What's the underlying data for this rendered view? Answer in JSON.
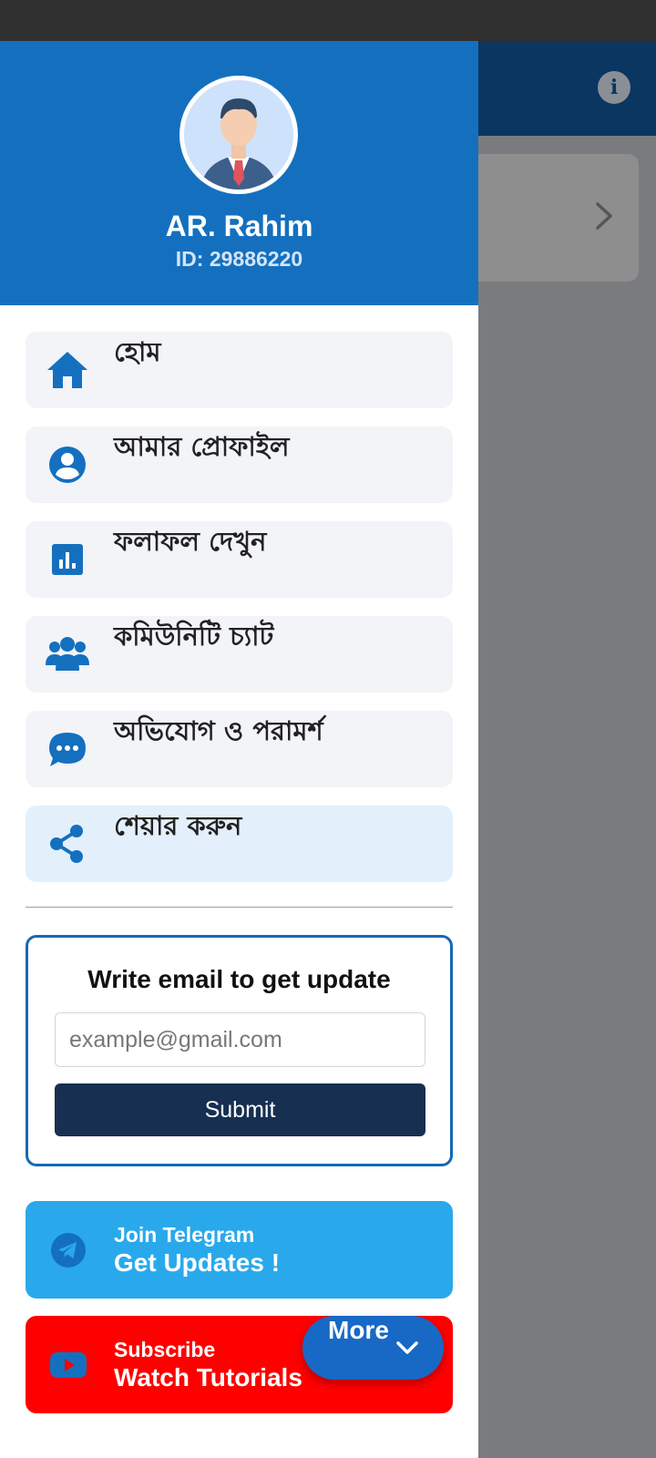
{
  "profile": {
    "name": "AR. Rahim",
    "id_text": "ID: 29886220"
  },
  "menu": {
    "items": [
      {
        "label": "হোম",
        "icon": "home-icon"
      },
      {
        "label": "আমার প্রোফাইল",
        "icon": "account-circle-icon"
      },
      {
        "label": "ফলাফল দেখুন",
        "icon": "bar-chart-icon"
      },
      {
        "label": "কমিউনিটি চ্যাট",
        "icon": "people-icon"
      },
      {
        "label": "অভিযোগ ও পরামর্শ",
        "icon": "chat-bubble-icon"
      },
      {
        "label": "শেয়ার করুন",
        "icon": "share-icon",
        "highlighted": true
      }
    ]
  },
  "subscribe": {
    "title": "Write email to get update",
    "placeholder": "example@gmail.com",
    "submit_label": "Submit"
  },
  "telegram": {
    "small": "Join Telegram",
    "big": "Get Updates !",
    "icon": "telegram-icon"
  },
  "youtube": {
    "small": "Subscribe",
    "big": "Watch Tutorials",
    "icon": "youtube-icon"
  },
  "more_button": {
    "label": "More",
    "icon": "chevron-down-icon"
  },
  "colors": {
    "primary": "#1470bf",
    "telegram": "#29a9eb",
    "youtube": "#ff0000",
    "submit": "#172f50"
  }
}
